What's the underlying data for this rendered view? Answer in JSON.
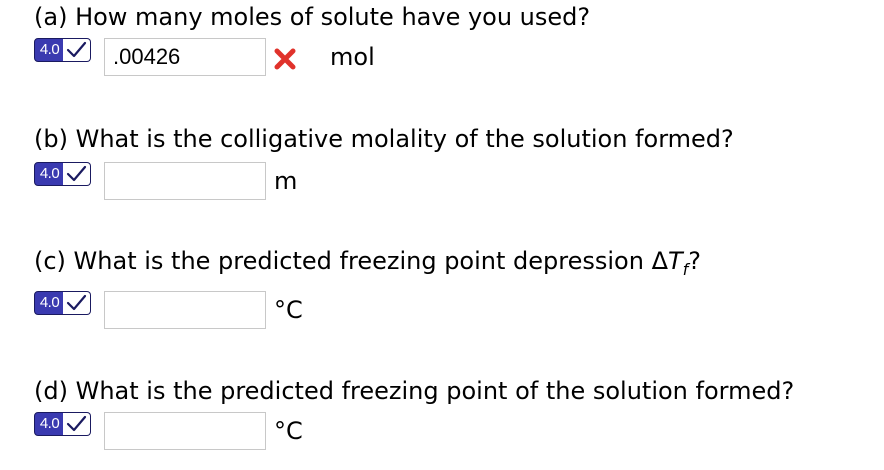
{
  "questions": [
    {
      "text": "(a) How many moles of solute have you used?",
      "badge_score": "4.0",
      "answer_value": ".00426",
      "status": "incorrect",
      "unit": "mol"
    },
    {
      "text": "(b) What is the colligative molality of the solution formed?",
      "badge_score": "4.0",
      "answer_value": "",
      "unit": "m"
    },
    {
      "text_prefix": "(c) What is the predicted freezing point depression Δ",
      "text_var": "T",
      "text_sub": "f",
      "text_suffix": "?",
      "badge_score": "4.0",
      "answer_value": "",
      "unit": "°C"
    },
    {
      "text": "(d) What is the predicted freezing point of the solution formed?",
      "badge_score": "4.0",
      "answer_value": "",
      "unit": "°C"
    }
  ],
  "colors": {
    "badge_fill": "#3a3ab0",
    "wrong_mark": "#e0322b",
    "input_border": "#c8c8c8"
  },
  "icons": {
    "badge_check": "checkmark-icon",
    "wrong": "red-x-icon"
  }
}
